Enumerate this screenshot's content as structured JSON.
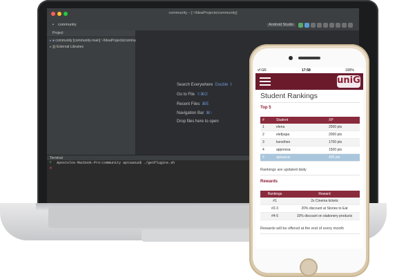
{
  "ide": {
    "window_title": "community – [~/IdeaProjects/community]",
    "breadcrumb": "community",
    "run_config": "Android Studio",
    "project_tool_label": "Project",
    "tree": [
      "community [community-main] ~/IdeaProjects/community",
      "External Libraries"
    ],
    "hints": [
      {
        "label": "Search Everywhere",
        "key": "Double ⇧"
      },
      {
        "label": "Go to File",
        "key": "⇧⌘O"
      },
      {
        "label": "Recent Files",
        "key": "⌘E"
      },
      {
        "label": "Navigation Bar",
        "key": "⌘↑"
      },
      {
        "label": "Drop files here to open",
        "key": ""
      }
    ],
    "terminal_label": "Terminal",
    "terminal_line": "Apostolos-Macbook-Pro:community aptsaous$ ./getPlugins.sh"
  },
  "phone": {
    "status": {
      "carrier": "vf GR",
      "time": "17:58",
      "battery": "100%"
    },
    "logo": "uniG",
    "title": "Student Rankings",
    "top5": {
      "heading": "Top 5",
      "columns": [
        "#",
        "Student",
        "XP"
      ],
      "rows": [
        [
          "1",
          "elena",
          "2500 pts"
        ],
        [
          "2",
          "elefpapa",
          "2000 pts"
        ],
        [
          "3",
          "konstheo",
          "1700 pts"
        ],
        [
          "4",
          "appressa",
          "1500 pts"
        ],
        [
          "5",
          "aptsaous",
          "400 pts"
        ]
      ],
      "note": "Rankings are updated daily"
    },
    "rewards": {
      "heading": "Rewards",
      "columns": [
        "Rankings",
        "Reward"
      ],
      "rows": [
        [
          "#1",
          "2x Cinema tickets"
        ],
        [
          "#2-3",
          "20% discount at Stories to Eat"
        ],
        [
          "#4-5",
          "10% discount on stationery products"
        ]
      ],
      "note": "Rewards will be offered at the end of every month"
    }
  },
  "colors": {
    "brand": "#8a1f35",
    "highlight": "#a9c6dd"
  }
}
